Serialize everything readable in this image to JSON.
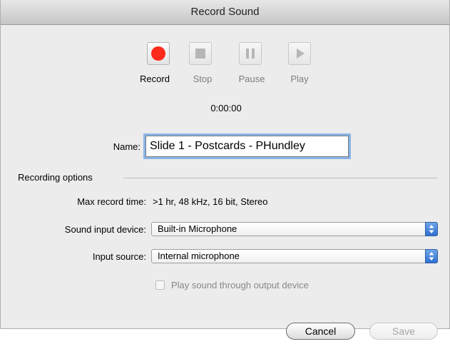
{
  "window": {
    "title": "Record Sound"
  },
  "transport": {
    "record_label": "Record",
    "stop_label": "Stop",
    "pause_label": "Pause",
    "play_label": "Play",
    "elapsed_time": "0:00:00"
  },
  "name_field": {
    "label": "Name:",
    "value": "Slide 1 - Postcards - PHundley"
  },
  "recording_options": {
    "section_title": "Recording options",
    "max_record_time_label": "Max record time:",
    "max_record_time_value": ">1 hr, 48 kHz, 16 bit, Stereo",
    "sound_input_device_label": "Sound input device:",
    "sound_input_device_value": "Built-in Microphone",
    "input_source_label": "Input source:",
    "input_source_value": "Internal microphone",
    "play_through_label": "Play sound through output device",
    "play_through_checked": false
  },
  "buttons": {
    "cancel_label": "Cancel",
    "save_label": "Save"
  },
  "colors": {
    "record_red": "#ff2a1a",
    "focus_ring": "#8ab4e8",
    "popup_arrow_blue": "#3a7bd5"
  },
  "icons": [
    "record-icon",
    "stop-icon",
    "pause-icon",
    "play-icon",
    "popup-arrows-icon"
  ]
}
